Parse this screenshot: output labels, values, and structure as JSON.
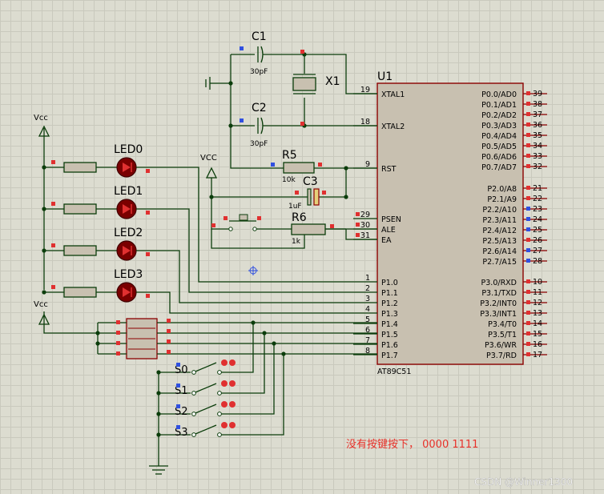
{
  "chip": {
    "ref": "U1",
    "part": "AT89C51"
  },
  "left_pins": [
    {
      "num": "19",
      "name": "XTAL1"
    },
    {
      "num": "18",
      "name": "XTAL2"
    },
    {
      "num": "9",
      "name": "RST"
    },
    {
      "num": "29",
      "name": "PSEN"
    },
    {
      "num": "30",
      "name": "ALE"
    },
    {
      "num": "31",
      "name": "EA"
    },
    {
      "num": "1",
      "name": "P1.0"
    },
    {
      "num": "2",
      "name": "P1.1"
    },
    {
      "num": "3",
      "name": "P1.2"
    },
    {
      "num": "4",
      "name": "P1.3"
    },
    {
      "num": "5",
      "name": "P1.4"
    },
    {
      "num": "6",
      "name": "P1.5"
    },
    {
      "num": "7",
      "name": "P1.6"
    },
    {
      "num": "8",
      "name": "P1.7"
    }
  ],
  "right_pins": [
    {
      "num": "39",
      "name": "P0.0/AD0"
    },
    {
      "num": "38",
      "name": "P0.1/AD1"
    },
    {
      "num": "37",
      "name": "P0.2/AD2"
    },
    {
      "num": "36",
      "name": "P0.3/AD3"
    },
    {
      "num": "35",
      "name": "P0.4/AD4"
    },
    {
      "num": "34",
      "name": "P0.5/AD5"
    },
    {
      "num": "33",
      "name": "P0.6/AD6"
    },
    {
      "num": "32",
      "name": "P0.7/AD7"
    },
    {
      "num": "21",
      "name": "P2.0/A8"
    },
    {
      "num": "22",
      "name": "P2.1/A9"
    },
    {
      "num": "23",
      "name": "P2.2/A10"
    },
    {
      "num": "24",
      "name": "P2.3/A11"
    },
    {
      "num": "25",
      "name": "P2.4/A12"
    },
    {
      "num": "26",
      "name": "P2.5/A13"
    },
    {
      "num": "27",
      "name": "P2.6/A14"
    },
    {
      "num": "28",
      "name": "P2.7/A15"
    },
    {
      "num": "10",
      "name": "P3.0/RXD"
    },
    {
      "num": "11",
      "name": "P3.1/TXD"
    },
    {
      "num": "12",
      "name": "P3.2/INT0"
    },
    {
      "num": "13",
      "name": "P3.3/INT1"
    },
    {
      "num": "14",
      "name": "P3.4/T0"
    },
    {
      "num": "15",
      "name": "P3.5/T1"
    },
    {
      "num": "16",
      "name": "P3.6/WR"
    },
    {
      "num": "17",
      "name": "P3.7/RD"
    }
  ],
  "components": {
    "c1": {
      "ref": "C1",
      "value": "30pF"
    },
    "c2": {
      "ref": "C2",
      "value": "30pF"
    },
    "x1": {
      "ref": "X1"
    },
    "r5": {
      "ref": "R5",
      "value": "10k"
    },
    "c3": {
      "ref": "C3",
      "value": "1uF"
    },
    "r6": {
      "ref": "R6",
      "value": "1k"
    },
    "leds": [
      "LED0",
      "LED1",
      "LED2",
      "LED3"
    ],
    "switches": [
      "S0",
      "S1",
      "S2",
      "S3"
    ]
  },
  "power": {
    "vcc1": "Vcc",
    "vcc2": "Vcc",
    "vcc3": "VCC"
  },
  "note": "没有按键按下， 0000 1111",
  "watermark": "CSDN @Winner1300",
  "colors": {
    "wire": "#0b3d0b",
    "body": "#c8c0b0",
    "note": "#e8312a",
    "marker_red": "#e03030",
    "marker_blue": "#3050e0"
  }
}
